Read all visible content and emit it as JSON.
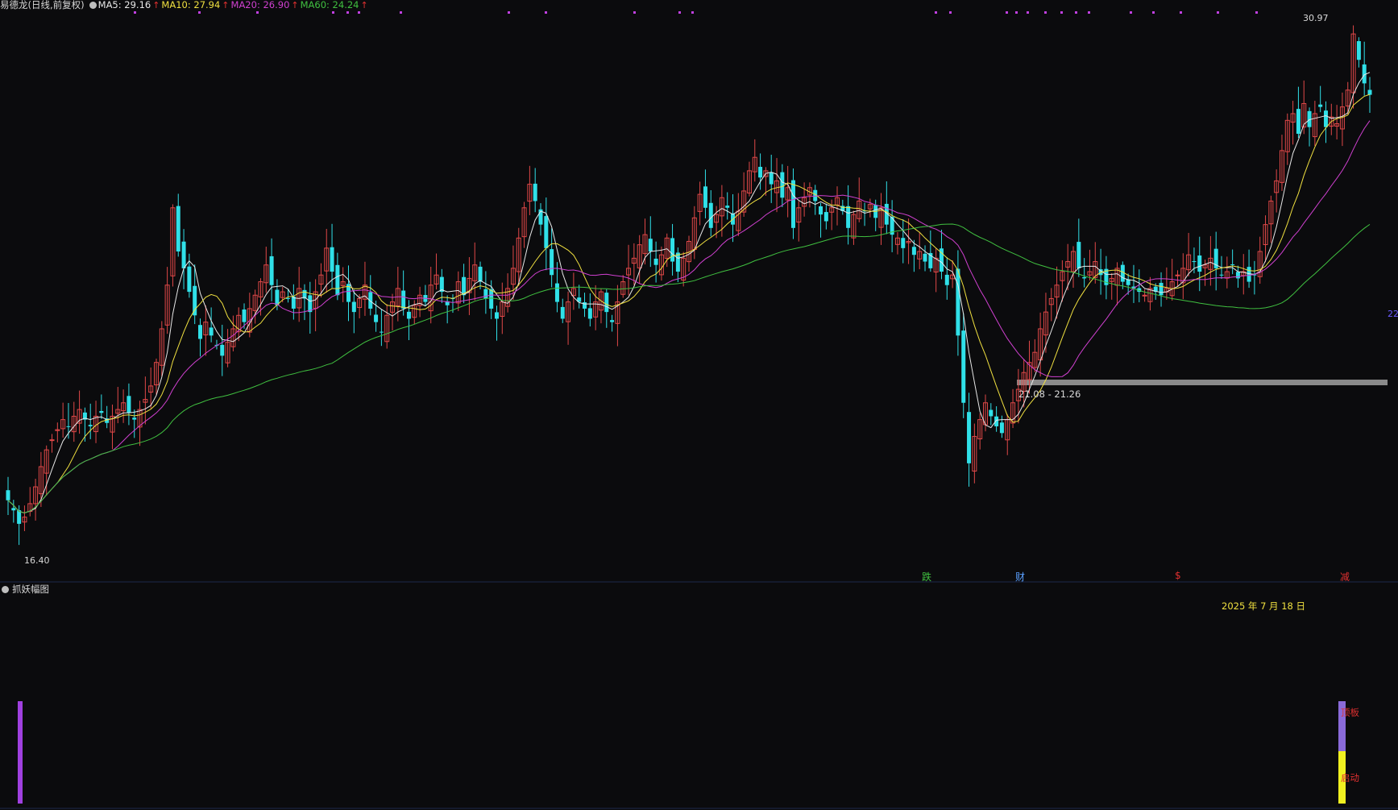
{
  "header": {
    "stock_title": "易德龙(日线,前复权)",
    "ma5_label": "MA5: 29.16",
    "ma10_label": "MA10: 27.94",
    "ma20_label": "MA20: 26.90",
    "ma60_label": "MA60: 24.24",
    "up_arrow": "↑",
    "colors": {
      "ma5": "#e8e8e8",
      "ma10": "#f0e040",
      "ma20": "#d040d0",
      "ma60": "#40c040"
    }
  },
  "price_labels": {
    "high": "30.97",
    "low": "16.40",
    "right_price": "22",
    "gap_range": "21.08 - 21.26"
  },
  "events": [
    {
      "text": "跌",
      "color": "#40c040"
    },
    {
      "text": "财",
      "color": "#5aa0ff"
    },
    {
      "text": "$",
      "color": "#e03030"
    },
    {
      "text": "减",
      "color": "#e03030"
    }
  ],
  "sub_panel": {
    "title": "抓妖幅图",
    "date": "2025 年 7 月 18 日",
    "signal_top": "顶板",
    "signal_bottom": "启动"
  },
  "colors": {
    "up": "#e04848",
    "down": "#30e0e8",
    "background": "#0b0b0d",
    "gap_band": "#8a8a8a"
  },
  "chart_data": {
    "type": "candlestick",
    "title": "易德龙(日线,前复权)",
    "high_label": 30.97,
    "low_label": 16.4,
    "gap_band": [
      21.08,
      21.26
    ],
    "closes": [
      17.1,
      16.8,
      16.4,
      16.6,
      17.0,
      17.5,
      18.1,
      18.6,
      18.9,
      19.2,
      19.5,
      19.3,
      19.6,
      19.8,
      19.5,
      19.3,
      19.6,
      19.7,
      19.4,
      19.6,
      19.8,
      20.0,
      19.7,
      19.5,
      19.8,
      20.1,
      20.5,
      21.2,
      22.2,
      23.5,
      25.8,
      24.5,
      24.0,
      23.3,
      22.6,
      21.9,
      22.4,
      22.0,
      21.7,
      21.4,
      21.8,
      22.2,
      22.6,
      22.4,
      22.8,
      23.2,
      23.6,
      24.1,
      23.5,
      22.9,
      23.3,
      23.1,
      22.8,
      23.4,
      23.1,
      22.7,
      23.3,
      23.8,
      24.6,
      23.9,
      23.2,
      23.6,
      23.0,
      22.7,
      23.1,
      23.5,
      22.8,
      22.4,
      22.1,
      22.6,
      23.0,
      23.4,
      22.8,
      22.5,
      22.9,
      23.2,
      23.0,
      23.5,
      23.8,
      23.3,
      22.9,
      23.1,
      23.6,
      23.2,
      23.7,
      24.1,
      23.6,
      23.1,
      22.8,
      22.5,
      23.0,
      23.4,
      24.0,
      24.9,
      25.8,
      26.5,
      26.0,
      25.3,
      24.6,
      23.8,
      23.0,
      22.5,
      23.0,
      23.4,
      23.0,
      22.8,
      22.5,
      23.0,
      23.3,
      22.7,
      22.4,
      23.0,
      23.6,
      24.0,
      24.3,
      24.7,
      25.0,
      24.5,
      24.1,
      24.4,
      24.9,
      24.2,
      23.9,
      24.3,
      24.8,
      25.5,
      26.2,
      25.8,
      25.2,
      25.6,
      26.1,
      25.8,
      25.3,
      25.7,
      26.3,
      26.9,
      27.3,
      26.7,
      26.9,
      26.5,
      26.6,
      26.1,
      26.4,
      25.2,
      25.8,
      26.1,
      26.4,
      26.0,
      25.6,
      25.4,
      25.8,
      26.1,
      25.7,
      25.2,
      25.6,
      26.0,
      25.7,
      25.9,
      25.5,
      25.8,
      25.3,
      25.0,
      24.9,
      24.6,
      24.8,
      24.4,
      24.5,
      24.2,
      24.0,
      24.3,
      23.9,
      23.5,
      23.8,
      22.0,
      20.0,
      18.2,
      19.0,
      19.5,
      20.0,
      19.6,
      19.3,
      19.1,
      19.5,
      20.0,
      20.4,
      20.9,
      21.2,
      21.5,
      22.2,
      22.7,
      23.1,
      23.5,
      23.9,
      24.2,
      24.5,
      24.0,
      23.7,
      23.9,
      24.2,
      23.8,
      23.5,
      23.7,
      24.0,
      23.6,
      23.5,
      23.4,
      23.3,
      23.2,
      23.4,
      23.3,
      23.2,
      23.4,
      23.6,
      23.8,
      24.0,
      24.4,
      24.2,
      23.9,
      24.1,
      24.3,
      24.0,
      23.8,
      23.9,
      24.1,
      23.7,
      23.9,
      23.6,
      23.8,
      24.5,
      25.3,
      26.0,
      26.6,
      27.5,
      28.4,
      28.6,
      28.0,
      28.9,
      28.2,
      28.6,
      28.8,
      28.2,
      28.5,
      28.3,
      28.8,
      29.3,
      30.97,
      30.2,
      29.5,
      29.16
    ]
  }
}
